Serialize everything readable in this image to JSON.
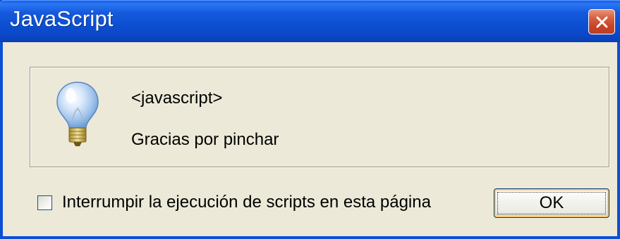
{
  "window": {
    "title": "JavaScript",
    "close_icon": "close-x-icon"
  },
  "message": {
    "icon": "lightbulb-icon",
    "header": "<javascript>",
    "body": "Gracias por pinchar"
  },
  "options": {
    "stop_scripts_label": "Interrumpir la ejecución de scripts en esta página",
    "stop_scripts_checked": false
  },
  "buttons": {
    "ok_label": "OK"
  },
  "colors": {
    "titlebar": "#0c4fd1",
    "dialog_bg": "#ece9d8",
    "close_button": "#c74326"
  }
}
